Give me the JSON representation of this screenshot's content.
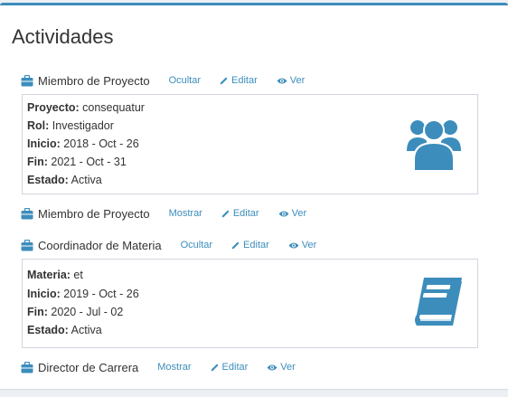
{
  "page": {
    "title": "Actividades"
  },
  "colors": {
    "accent": "#3c8dbc",
    "icon": "#3c8dbc",
    "border": "#d2d6de"
  },
  "activities": [
    {
      "role": "Miembro de Proyecto",
      "toggle": "Ocultar",
      "edit": "Editar",
      "view": "Ver",
      "expanded": true,
      "icon": "users-icon",
      "details": [
        {
          "label": "Proyecto:",
          "value": "consequatur"
        },
        {
          "label": "Rol:",
          "value": "Investigador"
        },
        {
          "label": "Inicio:",
          "value": "2018 - Oct - 26"
        },
        {
          "label": "Fin:",
          "value": "2021 - Oct - 31"
        },
        {
          "label": "Estado:",
          "value": "Activa"
        }
      ]
    },
    {
      "role": "Miembro de Proyecto",
      "toggle": "Mostrar",
      "edit": "Editar",
      "view": "Ver",
      "expanded": false
    },
    {
      "role": "Coordinador de Materia",
      "toggle": "Ocultar",
      "edit": "Editar",
      "view": "Ver",
      "expanded": true,
      "icon": "book-icon",
      "details": [
        {
          "label": "Materia:",
          "value": "et"
        },
        {
          "label": "Inicio:",
          "value": "2019 - Oct - 26"
        },
        {
          "label": "Fin:",
          "value": "2020 - Jul - 02"
        },
        {
          "label": "Estado:",
          "value": "Activa"
        }
      ]
    },
    {
      "role": "Director de Carrera",
      "toggle": "Mostrar",
      "edit": "Editar",
      "view": "Ver",
      "expanded": false
    }
  ]
}
